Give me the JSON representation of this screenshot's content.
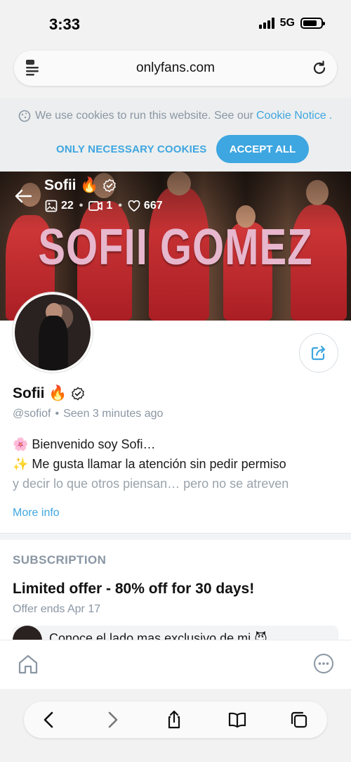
{
  "status_bar": {
    "time": "3:33",
    "network": "5G",
    "battery_level": 0.8
  },
  "browser": {
    "url": "onlyfans.com"
  },
  "cookie_banner": {
    "text": "We use cookies to run this website. See our",
    "link": "Cookie Notice",
    "period": ".",
    "necessary_label": "ONLY NECESSARY COOKIES",
    "accept_label": "ACCEPT ALL"
  },
  "cover": {
    "title_overlay": "SOFII GOMEZ",
    "name": "Sofii 🔥",
    "photos": "22",
    "videos": "1",
    "likes": "667",
    "separator": "•"
  },
  "profile": {
    "name": "Sofii 🔥",
    "handle": "@sofiof",
    "separator": "•",
    "seen": "Seen  3 minutes ago",
    "bio_line1": "🌸 Bienvenido soy Sofi…",
    "bio_line2": "✨ Me gusta llamar la atención sin pedir permiso",
    "bio_line3": "y decir lo que otros piensan… pero no se atreven",
    "more_info": "More info"
  },
  "subscription": {
    "section_title": "SUBSCRIPTION",
    "offer_title": "Limited offer - 80% off for 30 days!",
    "offer_ends": "Offer ends Apr 17",
    "promo_text": "Conoce el lado mas exclusivo de mi 😈"
  },
  "icons": {
    "cookie": "cookie-icon",
    "reader": "reader-icon",
    "reload": "reload-icon",
    "back": "arrow-left-icon",
    "verified": "verified-badge-icon",
    "photo": "image-icon",
    "video": "video-icon",
    "heart": "heart-icon",
    "share": "share-icon",
    "home": "home-icon",
    "more": "more-icon"
  },
  "colors": {
    "accent": "#3ea6e0",
    "muted": "#8a96a3",
    "cover_title": "#e7b7cd"
  }
}
